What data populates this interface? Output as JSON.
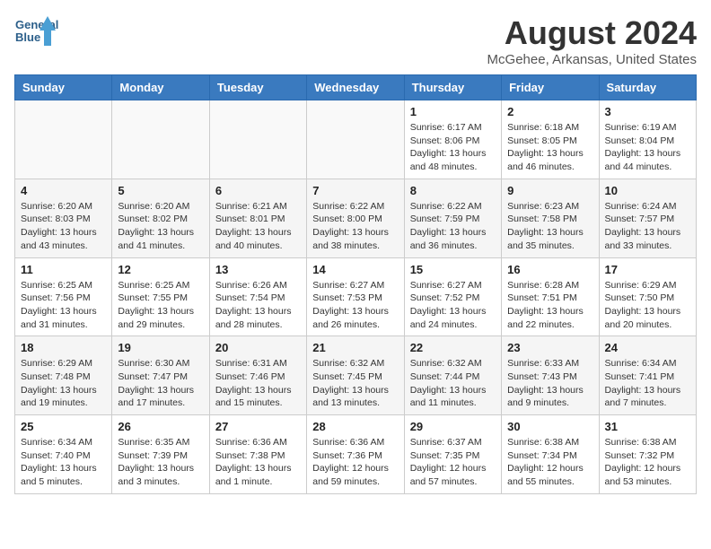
{
  "header": {
    "logo_line1": "General",
    "logo_line2": "Blue",
    "month_year": "August 2024",
    "location": "McGehee, Arkansas, United States"
  },
  "days_of_week": [
    "Sunday",
    "Monday",
    "Tuesday",
    "Wednesday",
    "Thursday",
    "Friday",
    "Saturday"
  ],
  "weeks": [
    [
      {
        "day": "",
        "info": ""
      },
      {
        "day": "",
        "info": ""
      },
      {
        "day": "",
        "info": ""
      },
      {
        "day": "",
        "info": ""
      },
      {
        "day": "1",
        "info": "Sunrise: 6:17 AM\nSunset: 8:06 PM\nDaylight: 13 hours\nand 48 minutes."
      },
      {
        "day": "2",
        "info": "Sunrise: 6:18 AM\nSunset: 8:05 PM\nDaylight: 13 hours\nand 46 minutes."
      },
      {
        "day": "3",
        "info": "Sunrise: 6:19 AM\nSunset: 8:04 PM\nDaylight: 13 hours\nand 44 minutes."
      }
    ],
    [
      {
        "day": "4",
        "info": "Sunrise: 6:20 AM\nSunset: 8:03 PM\nDaylight: 13 hours\nand 43 minutes."
      },
      {
        "day": "5",
        "info": "Sunrise: 6:20 AM\nSunset: 8:02 PM\nDaylight: 13 hours\nand 41 minutes."
      },
      {
        "day": "6",
        "info": "Sunrise: 6:21 AM\nSunset: 8:01 PM\nDaylight: 13 hours\nand 40 minutes."
      },
      {
        "day": "7",
        "info": "Sunrise: 6:22 AM\nSunset: 8:00 PM\nDaylight: 13 hours\nand 38 minutes."
      },
      {
        "day": "8",
        "info": "Sunrise: 6:22 AM\nSunset: 7:59 PM\nDaylight: 13 hours\nand 36 minutes."
      },
      {
        "day": "9",
        "info": "Sunrise: 6:23 AM\nSunset: 7:58 PM\nDaylight: 13 hours\nand 35 minutes."
      },
      {
        "day": "10",
        "info": "Sunrise: 6:24 AM\nSunset: 7:57 PM\nDaylight: 13 hours\nand 33 minutes."
      }
    ],
    [
      {
        "day": "11",
        "info": "Sunrise: 6:25 AM\nSunset: 7:56 PM\nDaylight: 13 hours\nand 31 minutes."
      },
      {
        "day": "12",
        "info": "Sunrise: 6:25 AM\nSunset: 7:55 PM\nDaylight: 13 hours\nand 29 minutes."
      },
      {
        "day": "13",
        "info": "Sunrise: 6:26 AM\nSunset: 7:54 PM\nDaylight: 13 hours\nand 28 minutes."
      },
      {
        "day": "14",
        "info": "Sunrise: 6:27 AM\nSunset: 7:53 PM\nDaylight: 13 hours\nand 26 minutes."
      },
      {
        "day": "15",
        "info": "Sunrise: 6:27 AM\nSunset: 7:52 PM\nDaylight: 13 hours\nand 24 minutes."
      },
      {
        "day": "16",
        "info": "Sunrise: 6:28 AM\nSunset: 7:51 PM\nDaylight: 13 hours\nand 22 minutes."
      },
      {
        "day": "17",
        "info": "Sunrise: 6:29 AM\nSunset: 7:50 PM\nDaylight: 13 hours\nand 20 minutes."
      }
    ],
    [
      {
        "day": "18",
        "info": "Sunrise: 6:29 AM\nSunset: 7:48 PM\nDaylight: 13 hours\nand 19 minutes."
      },
      {
        "day": "19",
        "info": "Sunrise: 6:30 AM\nSunset: 7:47 PM\nDaylight: 13 hours\nand 17 minutes."
      },
      {
        "day": "20",
        "info": "Sunrise: 6:31 AM\nSunset: 7:46 PM\nDaylight: 13 hours\nand 15 minutes."
      },
      {
        "day": "21",
        "info": "Sunrise: 6:32 AM\nSunset: 7:45 PM\nDaylight: 13 hours\nand 13 minutes."
      },
      {
        "day": "22",
        "info": "Sunrise: 6:32 AM\nSunset: 7:44 PM\nDaylight: 13 hours\nand 11 minutes."
      },
      {
        "day": "23",
        "info": "Sunrise: 6:33 AM\nSunset: 7:43 PM\nDaylight: 13 hours\nand 9 minutes."
      },
      {
        "day": "24",
        "info": "Sunrise: 6:34 AM\nSunset: 7:41 PM\nDaylight: 13 hours\nand 7 minutes."
      }
    ],
    [
      {
        "day": "25",
        "info": "Sunrise: 6:34 AM\nSunset: 7:40 PM\nDaylight: 13 hours\nand 5 minutes."
      },
      {
        "day": "26",
        "info": "Sunrise: 6:35 AM\nSunset: 7:39 PM\nDaylight: 13 hours\nand 3 minutes."
      },
      {
        "day": "27",
        "info": "Sunrise: 6:36 AM\nSunset: 7:38 PM\nDaylight: 13 hours\nand 1 minute."
      },
      {
        "day": "28",
        "info": "Sunrise: 6:36 AM\nSunset: 7:36 PM\nDaylight: 12 hours\nand 59 minutes."
      },
      {
        "day": "29",
        "info": "Sunrise: 6:37 AM\nSunset: 7:35 PM\nDaylight: 12 hours\nand 57 minutes."
      },
      {
        "day": "30",
        "info": "Sunrise: 6:38 AM\nSunset: 7:34 PM\nDaylight: 12 hours\nand 55 minutes."
      },
      {
        "day": "31",
        "info": "Sunrise: 6:38 AM\nSunset: 7:32 PM\nDaylight: 12 hours\nand 53 minutes."
      }
    ]
  ]
}
